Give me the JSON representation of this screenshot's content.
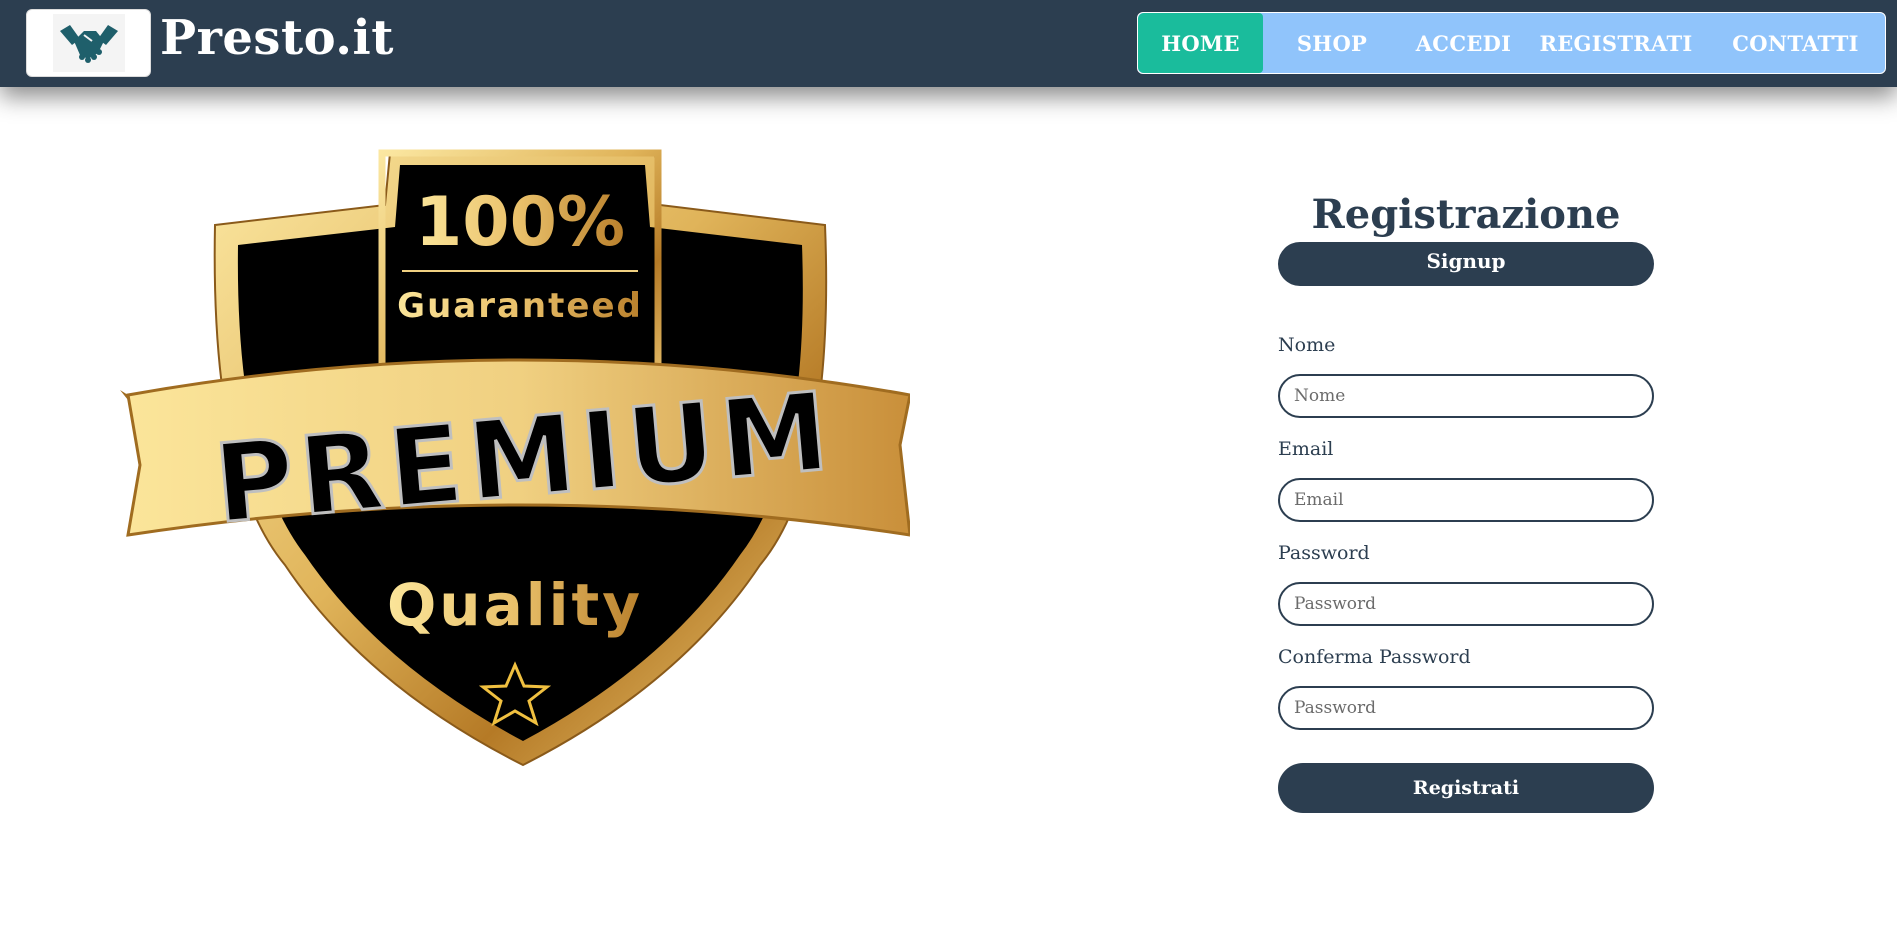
{
  "navbar": {
    "brand": "Presto.it",
    "logo_icon": "handshake-icon",
    "items": [
      {
        "label": "HOME",
        "active": true
      },
      {
        "label": "SHOP",
        "active": false
      },
      {
        "label": "ACCEDI",
        "active": false
      },
      {
        "label": "REGISTRATI",
        "active": false
      },
      {
        "label": "CONTATTI",
        "active": false
      }
    ]
  },
  "badge": {
    "percent": "100%",
    "guaranteed": "Guaranteed",
    "ribbon": "PREMIUM",
    "quality": "Quality",
    "icon": "star-icon"
  },
  "form": {
    "title": "Registrazione",
    "subtitle": "Signup",
    "fields": [
      {
        "label": "Nome",
        "placeholder": "Nome"
      },
      {
        "label": "Email",
        "placeholder": "Email"
      },
      {
        "label": "Password",
        "placeholder": "Password"
      },
      {
        "label": "Conferma Password",
        "placeholder": "Password"
      }
    ],
    "submit_label": "Registrati"
  },
  "colors": {
    "navbar_bg": "#2c3e50",
    "nav_menu_bg": "#90c4fb",
    "nav_active_bg": "#1abc9c",
    "primary": "#2c3e50",
    "gold": "#d4a24a"
  }
}
